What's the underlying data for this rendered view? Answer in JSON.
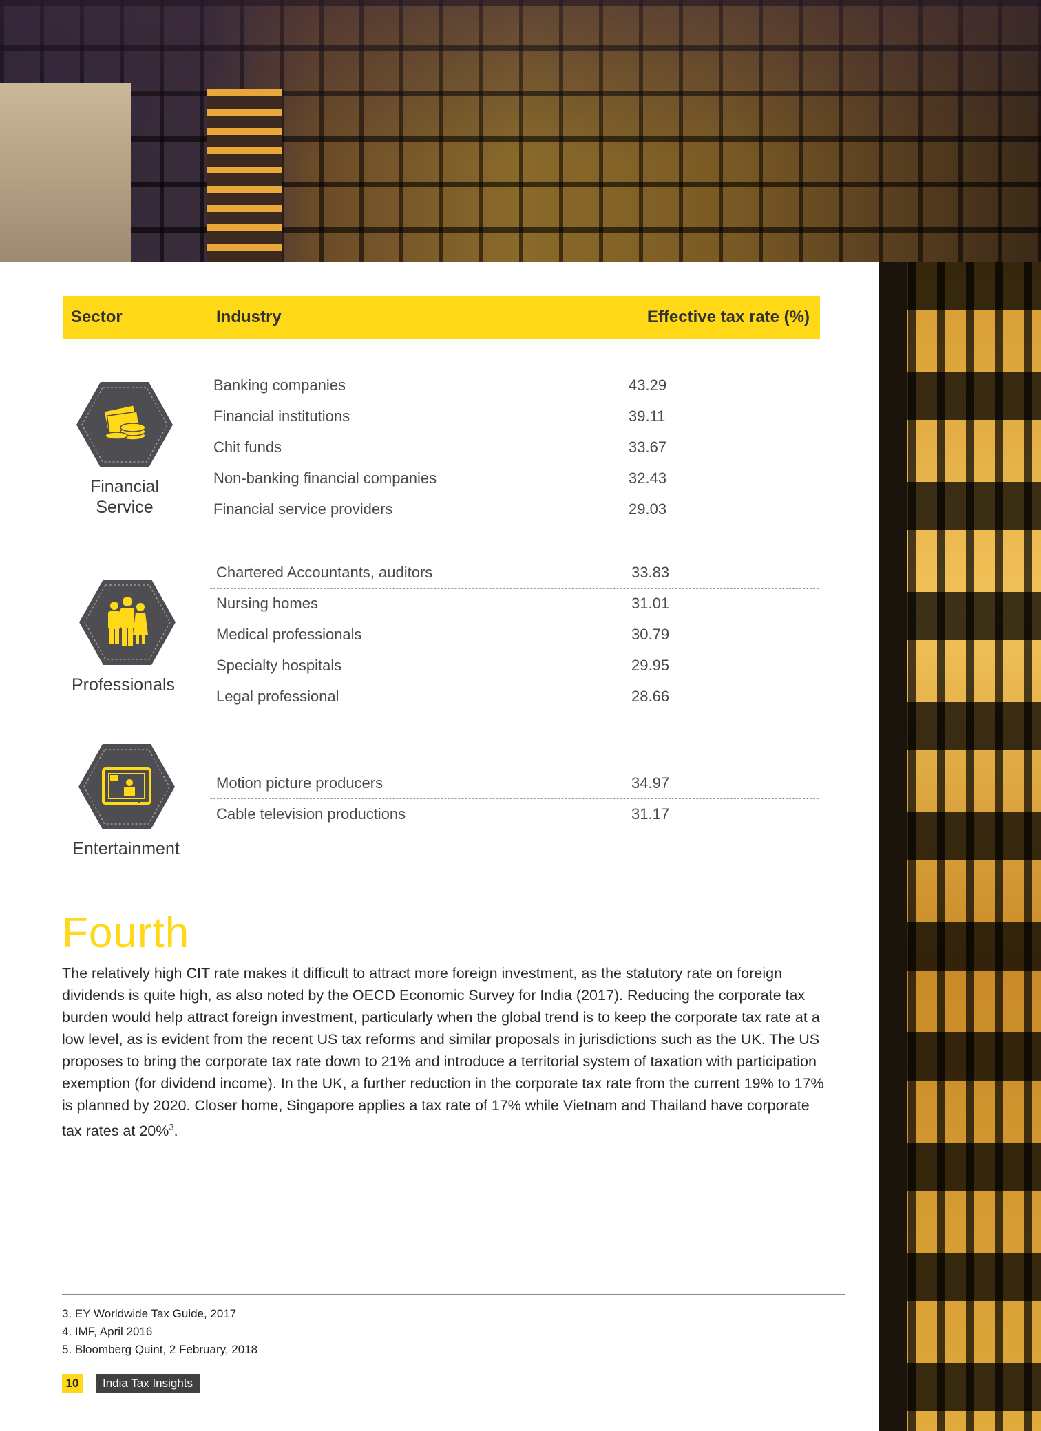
{
  "table": {
    "headers": {
      "sector": "Sector",
      "industry": "Industry",
      "rate": "Effective tax rate (%)"
    },
    "groups": [
      {
        "sector": "Financial\nService",
        "icon": "money-stack-icon",
        "rows": [
          {
            "industry": "Banking companies",
            "rate": "43.29"
          },
          {
            "industry": "Financial institutions",
            "rate": "39.11"
          },
          {
            "industry": "Chit funds",
            "rate": "33.67"
          },
          {
            "industry": "Non-banking financial companies",
            "rate": "32.43"
          },
          {
            "industry": "Financial service providers",
            "rate": "29.03"
          }
        ]
      },
      {
        "sector": "Professionals",
        "icon": "people-group-icon",
        "rows": [
          {
            "industry": "Chartered Accountants, auditors",
            "rate": "33.83"
          },
          {
            "industry": "Nursing homes",
            "rate": "31.01"
          },
          {
            "industry": "Medical professionals",
            "rate": "30.79"
          },
          {
            "industry": "Specialty hospitals",
            "rate": "29.95"
          },
          {
            "industry": "Legal professional",
            "rate": "28.66"
          }
        ]
      },
      {
        "sector": "Entertainment",
        "icon": "tv-icon",
        "rows": [
          {
            "industry": "Motion picture producers",
            "rate": "34.97"
          },
          {
            "industry": "Cable television productions",
            "rate": "31.17"
          }
        ]
      }
    ]
  },
  "section": {
    "heading": "Fourth",
    "body": "The relatively high CIT rate makes it difficult to attract more foreign investment, as the statutory rate on foreign dividends is quite high, as also noted by the OECD Economic Survey for India (2017). Reducing the corporate tax burden would help attract foreign investment, particularly when the global trend is to keep the corporate tax rate at a low level, as is evident from the recent US tax reforms and similar proposals in jurisdictions such as the UK. The US proposes to bring the corporate tax rate down to 21% and introduce a territorial system of taxation with participation exemption (for dividend income). In the UK, a further reduction in the corporate tax rate from the current 19% to 17% is planned by 2020. Closer home, Singapore applies a tax rate of 17% while Vietnam and Thailand have corporate tax rates at 20%",
    "footnote_ref": "3",
    "body_end": "."
  },
  "footnotes": [
    "3.  EY Worldwide Tax Guide, 2017",
    "4.  IMF, April 2016",
    "5.  Bloomberg Quint, 2 February, 2018"
  ],
  "footer": {
    "page_number": "10",
    "doc_title": "India Tax Insights"
  },
  "colors": {
    "accent": "#ffd817",
    "icon_bg": "#4d4d52",
    "text": "#4a4a4a"
  }
}
